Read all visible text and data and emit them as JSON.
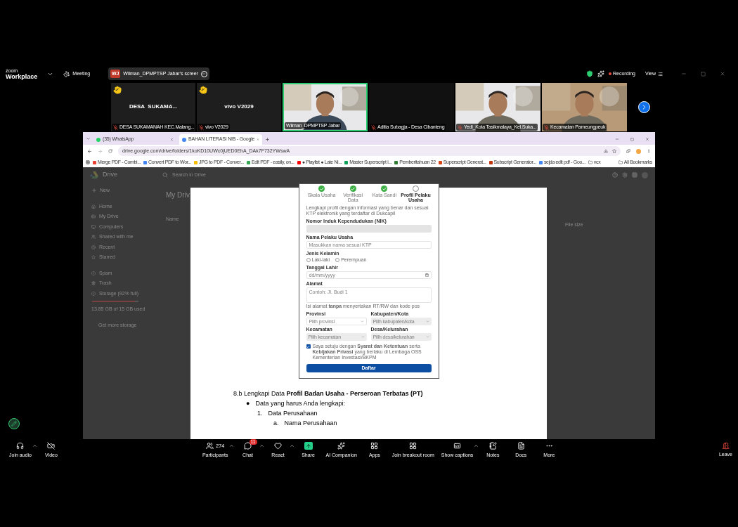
{
  "zoom_bar": {
    "app": "zoom",
    "product": "Workplace",
    "meeting_label": "Meeting",
    "share_pill": {
      "initials": "WJ",
      "label": "Wilman_DPMPTSP Jabar's screer"
    },
    "recording": "Recording",
    "view": "View"
  },
  "participants": [
    {
      "kind": "name",
      "display": "DESA  SUKAMA...",
      "name": "DESA SUKAMANAH KEC.Malang...",
      "hand_raised": true,
      "muted": true,
      "active_speaker": false
    },
    {
      "kind": "name",
      "display": "vivo V2029",
      "name": "vivo V2029",
      "hand_raised": true,
      "muted": true,
      "active_speaker": false
    },
    {
      "kind": "video",
      "name": "Wilman_DPMPTSP Jabar",
      "hand_raised": false,
      "muted": false,
      "active_speaker": true
    },
    {
      "kind": "blank",
      "name": "Aditia Subagja - Desa Cibanteng",
      "hand_raised": false,
      "muted": true,
      "active_speaker": false
    },
    {
      "kind": "video",
      "name": "Yedi_Kota Tasikmalaya_Kel.Suka...",
      "hand_raised": false,
      "muted": true,
      "active_speaker": false
    },
    {
      "kind": "video",
      "name": "Kecamatan Pameungpeuk",
      "hand_raised": false,
      "muted": true,
      "active_speaker": false
    }
  ],
  "browser": {
    "tabs": [
      {
        "title": "(35) WhatsApp",
        "selected": false
      },
      {
        "title": "BAHAN LITERASI NIB - Google",
        "selected": true
      }
    ],
    "url": "drive.google.com/drive/folders/1koKD10UWc0jUED0EhA_DAk7F732YWswA",
    "bookmarks": [
      "Merge PDF - Combi...",
      "Convert PDF to Wor...",
      "JPG to PDF - Conver...",
      "Edit PDF - easily, on...",
      "● Playlist ● Late Ni...",
      "Master Superscript i...",
      "Pemberitahuan 22",
      "Superscript Generat...",
      "Subscript Generator...",
      "sejda edit pdf - Goo...",
      "vcx"
    ],
    "all_bookmarks": "All Bookmarks"
  },
  "drive": {
    "logo": "Drive",
    "search_placeholder": "Search in Drive",
    "new_button": "New",
    "nav": [
      "Home",
      "My Drive",
      "Computers",
      "Shared with me",
      "Recent",
      "Starred",
      "Spam",
      "Trash"
    ],
    "storage": {
      "label": "Storage (92% full)",
      "level": 0.92,
      "usage": "13.85 GB of 15 GB used",
      "link": "Get more storage"
    },
    "title": "My Driv",
    "columns": [
      "Name",
      "File size"
    ]
  },
  "document": {
    "form": {
      "steps": [
        {
          "label": "Skala Usaha",
          "done": true
        },
        {
          "label": "Verifikasi Data",
          "done": true
        },
        {
          "label": "Kata Sandi",
          "done": true
        },
        {
          "label": "Profil Pelaku Usaha",
          "done": false
        }
      ],
      "intro": "Lengkapi profil dengan informasi yang benar dan sesuai KTP elektronik yang terdaftar di Dukcapil",
      "nik_label": "Nomor Induk Kependudukan (NIK)",
      "name_label": "Nama Pelaku Usaha",
      "name_placeholder": "Masukkan nama sesuai KTP",
      "gender_label": "Jenis Kelamin",
      "genders": [
        {
          "label": "Laki-laki",
          "selected": false
        },
        {
          "label": "Perempuan",
          "selected": false
        }
      ],
      "birth_label": "Tanggal Lahir",
      "birth_placeholder": "dd/mm/yyyy",
      "address_label": "Alamat",
      "address_placeholder": "Contoh: Jl. Budi 1",
      "address_note": "Isi alamat **tanpa** menyertakan RT/RW dan kode pos",
      "selects": [
        {
          "label": "Provinsi",
          "placeholder": "Pilih provinsi",
          "disabled": false
        },
        {
          "label": "Kabupaten/Kota",
          "placeholder": "Pilih kabupaten/kota",
          "disabled": true
        },
        {
          "label": "Kecamatan",
          "placeholder": "Pilih kecamatan",
          "disabled": true
        },
        {
          "label": "Desa/Kelurahan",
          "placeholder": "Pilih desa/kelurahan",
          "disabled": true
        }
      ],
      "agree": {
        "checked": true,
        "text": "Saya setuju dengan **Syarat dan Ketentuan** serta **Kebijakan Privasi** yang berlaku di Lembaga OSS Kementerian Investasi/BKPM"
      },
      "submit": "Daftar"
    },
    "heading": "8.b Lengkapi Data **Profil Badan Usaha - Perseroan Terbatas (PT)**",
    "bullet": {
      "marker": "●",
      "text": "Data yang harus Anda lengkapi:"
    },
    "numbered": {
      "marker": "1.",
      "text": "Data Perusahaan"
    },
    "lettered": {
      "marker": "a.",
      "text": "Nama Perusahaan"
    }
  },
  "toolbar": [
    {
      "label": "Join audio",
      "caret": true
    },
    {
      "label": "Video",
      "caret": false
    },
    {
      "label": "Participants",
      "count": "274",
      "caret": true
    },
    {
      "label": "Chat",
      "badge": "11",
      "caret": true
    },
    {
      "label": "React",
      "caret": true
    },
    {
      "label": "Share",
      "caret": false
    },
    {
      "label": "AI Companion",
      "caret": false
    },
    {
      "label": "Apps",
      "caret": false
    },
    {
      "label": "Join breakout room",
      "caret": false
    },
    {
      "label": "Show captions",
      "caret": true
    },
    {
      "label": "Notes",
      "caret": false
    },
    {
      "label": "Docs",
      "caret": false
    },
    {
      "label": "More",
      "caret": false
    }
  ],
  "leave": "Leave"
}
